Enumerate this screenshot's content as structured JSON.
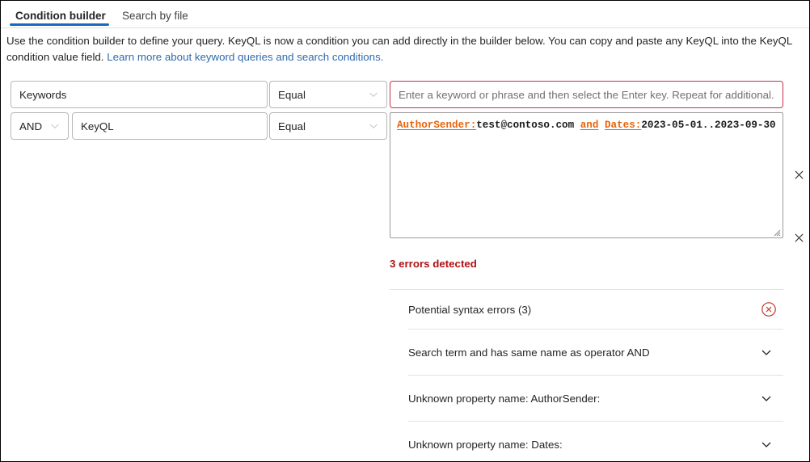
{
  "tabs": [
    {
      "label": "Condition builder",
      "selected": true
    },
    {
      "label": "Search by file",
      "selected": false
    }
  ],
  "accent_color": "#1668c1",
  "error_color": "#b01116",
  "keyql_error_color": "#e8630a",
  "input_error_border_color": "#c4314b",
  "description": {
    "text_before_link": "Use the condition builder to define your query. KeyQL is now a condition you can add directly in the builder below. You can copy and paste any KeyQL into the KeyQL condition value field. ",
    "link_text": "Learn more about keyword queries and search conditions."
  },
  "conditions": [
    {
      "conjunction": null,
      "field": "Keywords",
      "operator": "Equal",
      "value": "",
      "value_placeholder": "Enter a keyword or phrase and then select the Enter key. Repeat for additional...",
      "remove_label": "✕"
    },
    {
      "conjunction": "AND",
      "field": "KeyQL",
      "operator": "Equal",
      "value_segments": [
        {
          "text": "AuthorSender:",
          "error": true
        },
        {
          "text": "test@contoso.com ",
          "error": false
        },
        {
          "text": "and",
          "error": true
        },
        {
          "text": " ",
          "error": false
        },
        {
          "text": "Dates:",
          "error": true
        },
        {
          "text": "2023-05-01..2023-09-30",
          "error": false
        }
      ],
      "remove_label": "✕"
    }
  ],
  "errors": {
    "summary": "3 errors detected",
    "panel_title": "Potential syntax errors (3)",
    "dismiss_icon": "circle-x-icon",
    "items": [
      {
        "message": "Search term and has same name as operator AND"
      },
      {
        "message": "Unknown property name: AuthorSender:"
      },
      {
        "message": "Unknown property name: Dates:"
      }
    ]
  }
}
